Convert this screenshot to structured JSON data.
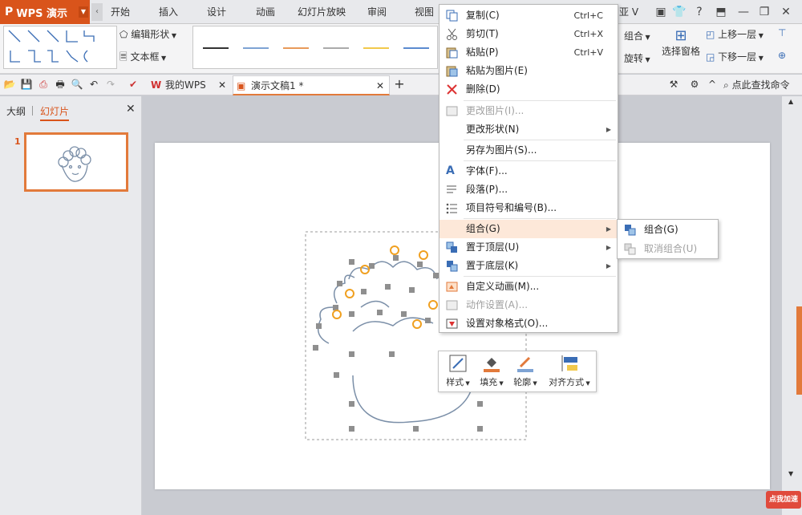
{
  "app": {
    "name": "WPS 演示",
    "logo_glyph": "P"
  },
  "menu_tabs": [
    "开始",
    "插入",
    "设计",
    "动画",
    "幻灯片放映",
    "审阅",
    "视图"
  ],
  "title_fragment": "亚 V",
  "ribbon": {
    "edit_shape_label": "编辑形状",
    "textbox_label": "文本框",
    "group_label": "组合",
    "rotate_label": "旋转",
    "selection_pane_label": "选择窗格",
    "bring_forward_label": "上移一层",
    "send_backward_label": "下移一层"
  },
  "quickbar": {
    "doc_tabs": [
      {
        "label": "我的WPS"
      },
      {
        "label": "演示文稿1 *"
      }
    ],
    "search_label": "点此查找命令"
  },
  "leftpanel": {
    "tab_outline": "大纲",
    "tab_slides": "幻灯片",
    "slide_number": "1"
  },
  "context_menu": {
    "items": [
      {
        "label": "复制(C)",
        "shortcut": "Ctrl+C",
        "icon": "copy-icon"
      },
      {
        "label": "剪切(T)",
        "shortcut": "Ctrl+X",
        "icon": "scissors-icon"
      },
      {
        "label": "粘贴(P)",
        "shortcut": "Ctrl+V",
        "icon": "paste-icon"
      },
      {
        "label": "粘贴为图片(E)",
        "icon": "paste-picture-icon"
      },
      {
        "label": "删除(D)",
        "icon": "delete-x-icon"
      },
      {
        "label": "更改图片(I)...",
        "icon": "change-picture-icon",
        "disabled": true
      },
      {
        "label": "更改形状(N)",
        "has_submenu": true
      },
      {
        "label": "另存为图片(S)..."
      },
      {
        "label": "字体(F)...",
        "icon": "font-a-icon"
      },
      {
        "label": "段落(P)...",
        "icon": "paragraph-icon"
      },
      {
        "label": "项目符号和编号(B)...",
        "icon": "bullets-icon"
      },
      {
        "label": "组合(G)",
        "has_submenu": true,
        "highlighted": true
      },
      {
        "label": "置于顶层(U)",
        "icon": "bring-to-front-icon",
        "has_submenu": true
      },
      {
        "label": "置于底层(K)",
        "icon": "send-to-back-icon",
        "has_submenu": true
      },
      {
        "label": "自定义动画(M)...",
        "icon": "custom-animation-icon"
      },
      {
        "label": "动作设置(A)...",
        "icon": "action-settings-icon",
        "disabled": true
      },
      {
        "label": "设置对象格式(O)...",
        "icon": "format-object-icon"
      }
    ]
  },
  "submenu": {
    "items": [
      {
        "label": "组合(G)",
        "icon": "group-icon"
      },
      {
        "label": "取消组合(U)",
        "icon": "ungroup-icon",
        "disabled": true
      }
    ]
  },
  "mini_toolbar": {
    "items": [
      {
        "label": "样式",
        "icon": "style-icon"
      },
      {
        "label": "填充",
        "icon": "fill-bucket-icon"
      },
      {
        "label": "轮廓",
        "icon": "outline-pen-icon"
      },
      {
        "label": "对齐方式",
        "icon": "align-icon"
      }
    ]
  },
  "badge": {
    "label": "点我加速"
  },
  "colors": {
    "accent": "#d9541b",
    "highlight": "#fde8d9",
    "selection_handle": "#8f8f8f",
    "rotate_handle": "#f0a020",
    "shape_stroke": "#7b8fa8"
  }
}
